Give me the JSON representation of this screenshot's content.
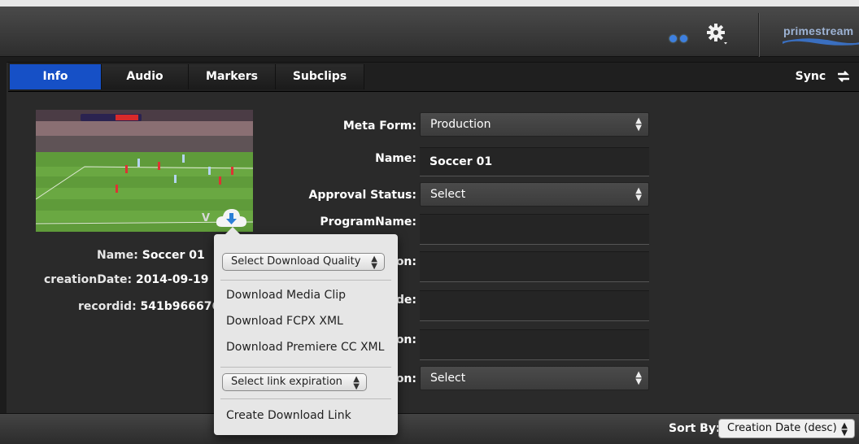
{
  "toolbar": {
    "brand": "primestream"
  },
  "tabs": [
    {
      "label": "Info"
    },
    {
      "label": "Audio"
    },
    {
      "label": "Markers"
    },
    {
      "label": "Subclips"
    }
  ],
  "sync_label": "Sync",
  "asset_info": {
    "name_label": "Name:",
    "name_value": "Soccer 01",
    "creation_label": "creationDate:",
    "creation_value": "2014-09-19",
    "recordid_label": "recordid:",
    "recordid_value": "541b966676"
  },
  "form": {
    "meta_form_label": "Meta Form:",
    "meta_form_value": "Production",
    "name_label": "Name:",
    "name_value": "Soccer 01",
    "approval_label": "Approval Status:",
    "approval_value": "Select",
    "program_label": "ProgramName:",
    "partial_labels": [
      "on:",
      "de:",
      "on:",
      "on:"
    ],
    "last_select_value": "Select"
  },
  "popup": {
    "quality_select": "Select Download Quality",
    "items": [
      "Download Media Clip",
      "Download FCPX XML",
      "Download Premiere CC XML"
    ],
    "expiration_select": "Select link expiration",
    "create_link": "Create Download Link"
  },
  "sort": {
    "label": "Sort By:",
    "value": "Creation Date (desc)"
  },
  "colors": {
    "accent_tab": "#1650c6",
    "toolbar_dots": "#3d7fe0",
    "brand": "#9db3d4"
  }
}
